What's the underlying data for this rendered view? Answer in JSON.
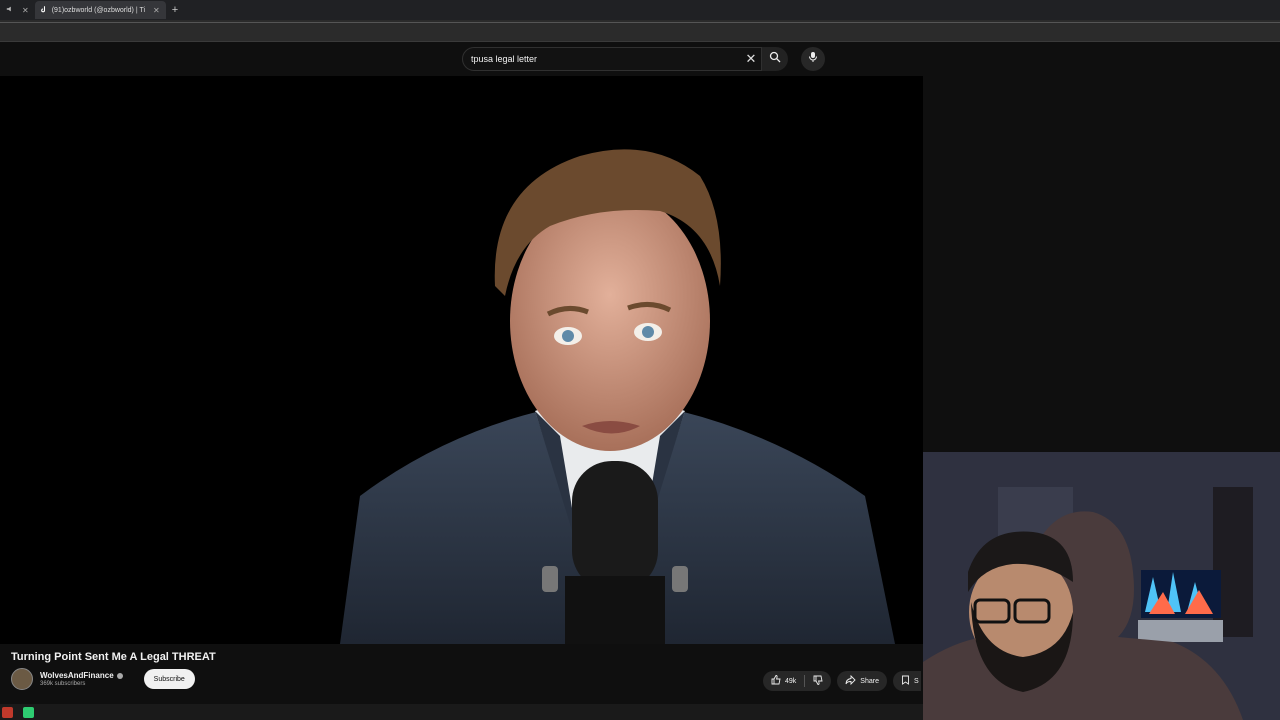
{
  "browser": {
    "tabs": [
      {
        "label": "",
        "active": false
      },
      {
        "label": "(91)ozbworld (@ozbworld) | Ti",
        "active": true
      }
    ]
  },
  "search": {
    "query": "tpusa legal letter"
  },
  "video": {
    "title": "Turning Point Sent Me A Legal THREAT",
    "channel_name": "WolvesAndFinance",
    "subscribers": "369k subscribers",
    "subscribe_label": "Subscribe",
    "likes": "49k",
    "share_label": "Share",
    "save_label": "S"
  },
  "colors": {
    "background": "#0f0f0f",
    "subscribe_bg": "#f1f1f1",
    "pill_bg": "#272727"
  },
  "icons": [
    "speaker-icon",
    "close-icon",
    "tiktok-icon",
    "plus-icon",
    "clear-icon",
    "search-icon",
    "mic-icon",
    "verified-icon",
    "like-icon",
    "dislike-icon",
    "share-icon",
    "save-icon"
  ]
}
